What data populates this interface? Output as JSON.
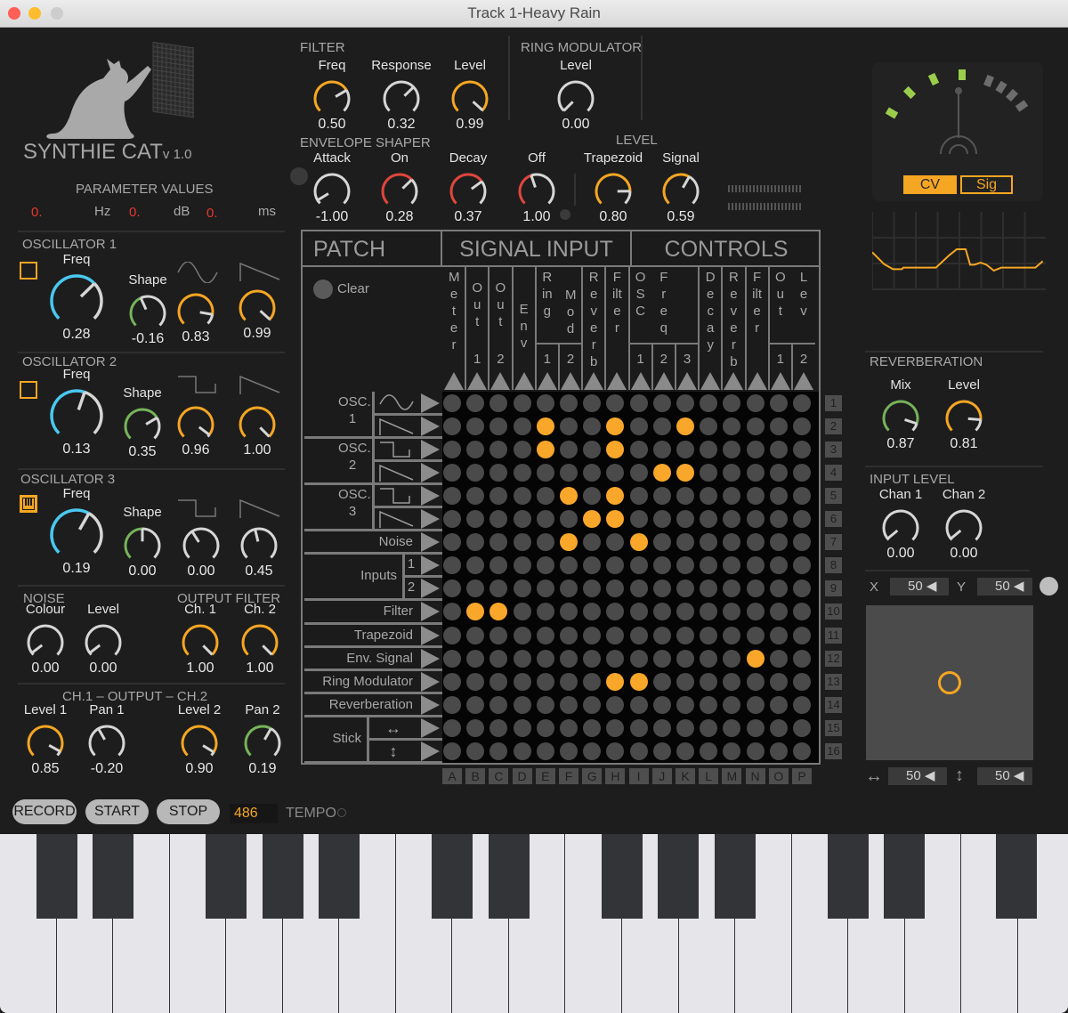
{
  "window": {
    "title": "Track 1-Heavy Rain"
  },
  "logo": {
    "name": "SYNTHIE CAT",
    "version": "v 1.0"
  },
  "parameter_values": {
    "title": "PARAMETER VALUES",
    "items": [
      {
        "value": "0.",
        "unit": "Hz"
      },
      {
        "value": "0.",
        "unit": "dB"
      },
      {
        "value": "0.",
        "unit": "ms"
      }
    ]
  },
  "knob_colors": {
    "orange": "#f5a623",
    "cyan": "#4ac8ef",
    "green": "#76b35a",
    "red": "#e0463c",
    "white": "#d6d6d6"
  },
  "filter": {
    "title": "FILTER",
    "knobs": [
      {
        "label": "Freq",
        "value": "0.50",
        "color": "orange",
        "level": 0.72
      },
      {
        "label": "Response",
        "value": "0.32",
        "color": "white",
        "level": 0.67
      },
      {
        "label": "Level",
        "value": "0.99",
        "color": "orange",
        "level": 0.99
      }
    ]
  },
  "ring_modulator": {
    "title": "RING MODULATOR",
    "knobs": [
      {
        "label": "Level",
        "value": "0.00",
        "color": "white",
        "level": 0.0
      }
    ]
  },
  "envelope": {
    "title": "ENVELOPE SHAPER",
    "knobs": [
      {
        "label": "Attack",
        "value": "-1.00",
        "color": "white",
        "level": 0.05
      },
      {
        "label": "On",
        "value": "0.28",
        "color": "red",
        "level": 0.67
      },
      {
        "label": "Decay",
        "value": "0.37",
        "color": "red",
        "level": 0.7
      },
      {
        "label": "Off",
        "value": "1.00",
        "color": "red",
        "level": 0.43
      }
    ]
  },
  "level": {
    "title": "LEVEL",
    "knobs": [
      {
        "label": "Trapezoid",
        "value": "0.80",
        "color": "orange",
        "level": 0.83
      },
      {
        "label": "Signal",
        "value": "0.59",
        "color": "orange",
        "level": 0.61
      }
    ]
  },
  "osc1": {
    "title": "OSCILLATOR 1",
    "enabled": false,
    "knobs": [
      {
        "label": "Freq",
        "value": "0.28",
        "color": "cyan",
        "level": 0.67
      },
      {
        "label": "Shape",
        "value": "-0.16",
        "color": "green",
        "level": 0.41
      },
      {
        "value": "0.83",
        "color": "orange",
        "level": 0.87
      },
      {
        "value": "0.99",
        "color": "orange",
        "level": 0.99
      }
    ]
  },
  "osc2": {
    "title": "OSCILLATOR 2",
    "enabled": false,
    "knobs": [
      {
        "label": "Freq",
        "value": "0.13",
        "color": "cyan",
        "level": 0.57
      },
      {
        "label": "Shape",
        "value": "0.35",
        "color": "green",
        "level": 0.72
      },
      {
        "value": "0.96",
        "color": "orange",
        "level": 0.97
      },
      {
        "value": "1.00",
        "color": "orange",
        "level": 1.0
      }
    ]
  },
  "osc3": {
    "title": "OSCILLATOR 3",
    "keyboard_mode": true,
    "knobs": [
      {
        "label": "Freq",
        "value": "0.19",
        "color": "cyan",
        "level": 0.61
      },
      {
        "label": "Shape",
        "value": "0.00",
        "color": "green",
        "level": 0.5
      },
      {
        "value": "0.00",
        "color": "white",
        "level": 0.38
      },
      {
        "value": "0.45",
        "color": "white",
        "level": 0.45
      }
    ]
  },
  "noise": {
    "title": "NOISE",
    "knobs": [
      {
        "label": "Colour",
        "value": "0.00",
        "color": "white",
        "level": 0.03
      },
      {
        "label": "Level",
        "value": "0.00",
        "color": "white",
        "level": 0.03
      }
    ]
  },
  "output_filter": {
    "title": "OUTPUT FILTER",
    "knobs": [
      {
        "label": "Ch. 1",
        "value": "1.00",
        "color": "orange",
        "level": 1.0
      },
      {
        "label": "Ch. 2",
        "value": "1.00",
        "color": "orange",
        "level": 1.0
      }
    ]
  },
  "output": {
    "title": "CH.1  –  OUTPUT  –  CH.2",
    "knobs": [
      {
        "label": "Level 1",
        "value": "0.85",
        "color": "orange",
        "level": 0.94
      },
      {
        "label": "Pan 1",
        "value": "-0.20",
        "color": "white",
        "level": 0.39
      },
      {
        "label": "Level 2",
        "value": "0.90",
        "color": "orange",
        "level": 0.95
      },
      {
        "label": "Pan 2",
        "value": "0.19",
        "color": "green",
        "level": 0.61
      }
    ]
  },
  "reverberation": {
    "title": "REVERBERATION",
    "knobs": [
      {
        "label": "Mix",
        "value": "0.87",
        "color": "green",
        "level": 0.9
      },
      {
        "label": "Level",
        "value": "0.81",
        "color": "orange",
        "level": 0.85
      }
    ]
  },
  "input_level": {
    "title": "INPUT LEVEL",
    "knobs": [
      {
        "label": "Chan 1",
        "value": "0.00",
        "color": "white",
        "level": 0.02
      },
      {
        "label": "Chan 2",
        "value": "0.00",
        "color": "white",
        "level": 0.02
      }
    ]
  },
  "meter": {
    "lit_segments": 4,
    "total_segments": 8,
    "modes": [
      "CV",
      "Sig"
    ],
    "active_mode": "CV"
  },
  "stick": {
    "x_label": "X",
    "y_label": "Y",
    "x": 50,
    "y": 50,
    "h_value": "50",
    "v_value": "50",
    "h_icon": "↔",
    "v_icon": "↕"
  },
  "patch": {
    "headers": {
      "patch": "PATCH",
      "signal_input": "SIGNAL INPUT",
      "controls": "CONTROLS"
    },
    "clear_label": "Clear",
    "columns": [
      {
        "word": "Meter",
        "num": ""
      },
      {
        "word": "Out",
        "num": "1"
      },
      {
        "word": "Out",
        "num": "2"
      },
      {
        "word": "Env",
        "num": ""
      },
      {
        "word": "Ring",
        "num": "1"
      },
      {
        "word": "Mod",
        "num": "2"
      },
      {
        "word": "Reverb",
        "num": ""
      },
      {
        "word": "Filter",
        "num": ""
      },
      {
        "word": "OSC",
        "num": "1"
      },
      {
        "word": "Freq",
        "num": "2"
      },
      {
        "word": "",
        "num": "3"
      },
      {
        "word": "Decay",
        "num": ""
      },
      {
        "word": "Reverb",
        "num": ""
      },
      {
        "word": "Filter",
        "num": ""
      },
      {
        "word": "Out",
        "num": "1"
      },
      {
        "word": "Lev",
        "num": "2"
      }
    ],
    "column_letters": [
      "A",
      "B",
      "C",
      "D",
      "E",
      "F",
      "G",
      "H",
      "I",
      "J",
      "K",
      "L",
      "M",
      "N",
      "O",
      "P"
    ],
    "row_numbers": [
      "1",
      "2",
      "3",
      "4",
      "5",
      "6",
      "7",
      "8",
      "9",
      "10",
      "11",
      "12",
      "13",
      "14",
      "15",
      "16"
    ],
    "row_groups": [
      {
        "label": "OSC.\n1",
        "sub": [
          "sine-wave",
          "saw-wave"
        ]
      },
      {
        "label": "OSC.\n2",
        "sub": [
          "square-wave",
          "saw-wave"
        ]
      },
      {
        "label": "OSC.\n3",
        "sub": [
          "square-wave",
          "saw-wave"
        ]
      },
      {
        "label": "Noise"
      },
      {
        "label": "Inputs",
        "sub": [
          "1",
          "2"
        ]
      },
      {
        "label": "Filter"
      },
      {
        "label": "Trapezoid"
      },
      {
        "label": "Env. Signal"
      },
      {
        "label": "Ring Modulator"
      },
      {
        "label": "Reverberation"
      },
      {
        "label": "Stick",
        "sub": [
          "↔",
          "↕"
        ]
      }
    ],
    "active_cells": [
      "E2",
      "H2",
      "K2",
      "E3",
      "H3",
      "J4",
      "K4",
      "F5",
      "H5",
      "G6",
      "H6",
      "F7",
      "I7",
      "B10",
      "C10",
      "N12",
      "H13",
      "I13"
    ]
  },
  "transport": {
    "record": "RECORD",
    "start": "START",
    "stop": "STOP",
    "tempo_value": "486",
    "tempo_label": "TEMPO"
  }
}
